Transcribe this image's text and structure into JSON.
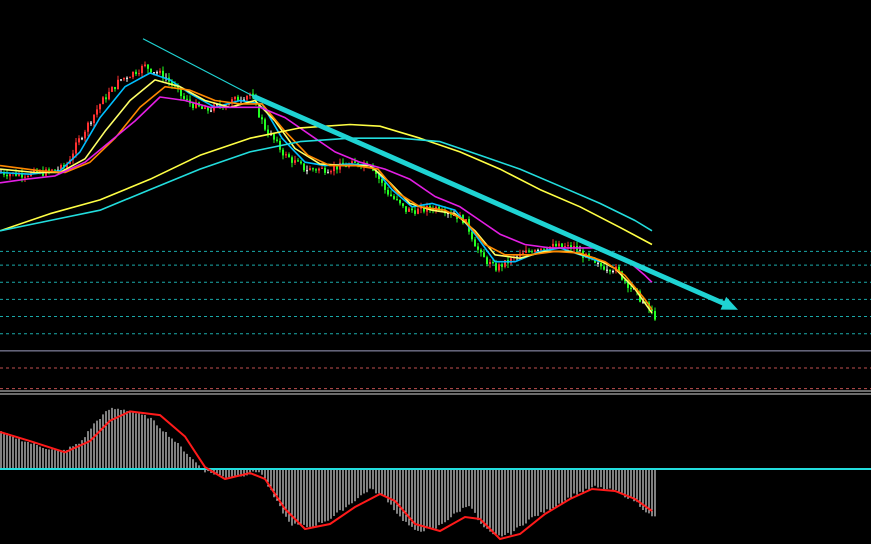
{
  "chart_data": [
    {
      "type": "candlestick",
      "panel": "price",
      "title": "",
      "xlabel": "",
      "ylabel": "",
      "ylim": [
        0,
        100
      ],
      "grid": false,
      "colors": {
        "up": "#ff3030",
        "down": "#22ff22",
        "doji": "#ffffff"
      },
      "price_path": [
        [
          0,
          57
        ],
        [
          20,
          56.5
        ],
        [
          45,
          57
        ],
        [
          65,
          58.5
        ],
        [
          80,
          67
        ],
        [
          100,
          77
        ],
        [
          120,
          84
        ],
        [
          145,
          88
        ],
        [
          165,
          85
        ],
        [
          185,
          78
        ],
        [
          205,
          75
        ],
        [
          225,
          77
        ],
        [
          250,
          80
        ],
        [
          265,
          70
        ],
        [
          285,
          62
        ],
        [
          305,
          58
        ],
        [
          325,
          58
        ],
        [
          345,
          59
        ],
        [
          370,
          60
        ],
        [
          385,
          52
        ],
        [
          405,
          46
        ],
        [
          420,
          46
        ],
        [
          440,
          47
        ],
        [
          465,
          43
        ],
        [
          480,
          33
        ],
        [
          495,
          29
        ],
        [
          515,
          32
        ],
        [
          535,
          35
        ],
        [
          555,
          35.5
        ],
        [
          575,
          35
        ],
        [
          595,
          30
        ],
        [
          615,
          29
        ],
        [
          635,
          22
        ],
        [
          655,
          15
        ]
      ],
      "moving_averages": [
        {
          "color": "#00bfff",
          "values": [
            [
              0,
              57
            ],
            [
              30,
              56.5
            ],
            [
              60,
              57.5
            ],
            [
              80,
              63
            ],
            [
              100,
              73
            ],
            [
              125,
              82
            ],
            [
              150,
              86
            ],
            [
              170,
              84
            ],
            [
              190,
              80
            ],
            [
              215,
              76
            ],
            [
              240,
              78
            ],
            [
              262,
              77
            ],
            [
              282,
              67
            ],
            [
              305,
              60
            ],
            [
              325,
              59
            ],
            [
              350,
              59.5
            ],
            [
              372,
              59
            ],
            [
              392,
              52
            ],
            [
              412,
              47
            ],
            [
              432,
              48
            ],
            [
              455,
              46
            ],
            [
              475,
              39
            ],
            [
              495,
              31
            ],
            [
              515,
              31
            ],
            [
              540,
              34
            ],
            [
              560,
              35
            ],
            [
              580,
              33
            ],
            [
              600,
              31
            ]
          ]
        },
        {
          "color": "#ffff66",
          "values": [
            [
              0,
              58
            ],
            [
              35,
              57
            ],
            [
              60,
              57
            ],
            [
              85,
              61
            ],
            [
              105,
              69
            ],
            [
              130,
              78
            ],
            [
              155,
              84
            ],
            [
              180,
              82
            ],
            [
              205,
              78
            ],
            [
              230,
              76
            ],
            [
              255,
              78
            ],
            [
              275,
              72
            ],
            [
              295,
              64
            ],
            [
              320,
              59.5
            ],
            [
              345,
              59
            ],
            [
              370,
              59
            ],
            [
              390,
              54
            ],
            [
              410,
              48
            ],
            [
              432,
              46
            ],
            [
              455,
              45
            ],
            [
              475,
              40
            ],
            [
              495,
              33
            ],
            [
              520,
              32
            ],
            [
              545,
              34
            ],
            [
              570,
              34
            ],
            [
              595,
              32
            ],
            [
              615,
              29
            ],
            [
              635,
              23
            ],
            [
              652,
              16
            ]
          ]
        },
        {
          "color": "#ff8800",
          "values": [
            [
              0,
              59
            ],
            [
              40,
              57.5
            ],
            [
              65,
              57
            ],
            [
              90,
              60
            ],
            [
              115,
              67
            ],
            [
              140,
              76
            ],
            [
              165,
              82
            ],
            [
              190,
              81
            ],
            [
              215,
              78
            ],
            [
              240,
              77
            ],
            [
              262,
              77
            ],
            [
              285,
              69
            ],
            [
              308,
              62
            ],
            [
              330,
              59
            ],
            [
              355,
              59
            ],
            [
              378,
              58
            ],
            [
              398,
              51
            ],
            [
              420,
              47
            ],
            [
              445,
              46
            ],
            [
              465,
              43
            ],
            [
              485,
              36
            ],
            [
              505,
              33
            ],
            [
              530,
              33
            ],
            [
              555,
              34
            ],
            [
              580,
              33.5
            ],
            [
              605,
              31
            ],
            [
              625,
              27
            ],
            [
              645,
              20
            ],
            [
              652,
              17
            ]
          ]
        },
        {
          "color": "#e31ee3",
          "values": [
            [
              0,
              54
            ],
            [
              25,
              55
            ],
            [
              55,
              56
            ],
            [
              85,
              60
            ],
            [
              110,
              66
            ],
            [
              135,
              72
            ],
            [
              160,
              79
            ],
            [
              185,
              78
            ],
            [
              210,
              76
            ],
            [
              235,
              76
            ],
            [
              260,
              76
            ],
            [
              285,
              73
            ],
            [
              310,
              68
            ],
            [
              335,
              63
            ],
            [
              360,
              60
            ],
            [
              385,
              58
            ],
            [
              410,
              55
            ],
            [
              435,
              50
            ],
            [
              460,
              47
            ],
            [
              480,
              43
            ],
            [
              500,
              39
            ],
            [
              525,
              36
            ],
            [
              550,
              35
            ],
            [
              575,
              35
            ],
            [
              600,
              35
            ],
            [
              625,
              32
            ],
            [
              645,
              27
            ],
            [
              652,
              25
            ]
          ]
        },
        {
          "color": "#ffff44",
          "values": [
            [
              0,
              40
            ],
            [
              50,
              45
            ],
            [
              100,
              49
            ],
            [
              150,
              55
            ],
            [
              200,
              62
            ],
            [
              250,
              67
            ],
            [
              300,
              70
            ],
            [
              350,
              71
            ],
            [
              380,
              70.5
            ],
            [
              420,
              67
            ],
            [
              460,
              63
            ],
            [
              500,
              58
            ],
            [
              540,
              52
            ],
            [
              580,
              47
            ],
            [
              620,
              41
            ],
            [
              652,
              36
            ]
          ]
        },
        {
          "color": "#22dddd",
          "values": [
            [
              0,
              40
            ],
            [
              50,
              43
            ],
            [
              100,
              46
            ],
            [
              150,
              52
            ],
            [
              200,
              58
            ],
            [
              250,
              63
            ],
            [
              300,
              66
            ],
            [
              350,
              67
            ],
            [
              400,
              67
            ],
            [
              440,
              66
            ],
            [
              480,
              62
            ],
            [
              520,
              58
            ],
            [
              560,
              53
            ],
            [
              600,
              48
            ],
            [
              635,
              43
            ],
            [
              652,
              40
            ]
          ]
        }
      ],
      "horizontal_levels": [
        {
          "value": 34,
          "color": "#1aa9a9",
          "style": "dotted"
        },
        {
          "value": 30,
          "color": "#1aa9a9",
          "style": "dotted"
        },
        {
          "value": 25,
          "color": "#1aa9a9",
          "style": "dotted"
        },
        {
          "value": 20,
          "color": "#1aa9a9",
          "style": "dotted"
        },
        {
          "value": 15,
          "color": "#1aa9a9",
          "style": "dotted"
        },
        {
          "value": 10,
          "color": "#1aa9a9",
          "style": "dotted"
        },
        {
          "value": 5,
          "color": "#9e9ec0",
          "style": "solid"
        },
        {
          "value": 0,
          "color": "#c05050",
          "style": "dotted"
        },
        {
          "value": -6,
          "color": "#c05050",
          "style": "dotted"
        }
      ],
      "trend_lines": [
        {
          "color": "#1fd3d3",
          "from": [
            143,
            96
          ],
          "to": [
            255,
            79
          ],
          "arrow": false
        },
        {
          "color": "#1fd3d3",
          "from": [
            255,
            79
          ],
          "to": [
            738,
            17
          ],
          "arrow": true
        }
      ]
    },
    {
      "type": "histogram",
      "panel": "oscillator",
      "title": "",
      "xlabel": "",
      "ylabel": "",
      "ylim": [
        -75,
        70
      ],
      "grid": false,
      "zero_line_color": "#22dddd",
      "bar_color": "#ffffff",
      "signal_color": "#ff1a1a",
      "histogram_path": [
        [
          0,
          40
        ],
        [
          30,
          28
        ],
        [
          60,
          18
        ],
        [
          80,
          28
        ],
        [
          95,
          50
        ],
        [
          110,
          65
        ],
        [
          125,
          64
        ],
        [
          150,
          55
        ],
        [
          175,
          30
        ],
        [
          195,
          8
        ],
        [
          205,
          -2
        ],
        [
          225,
          -8
        ],
        [
          245,
          -6
        ],
        [
          260,
          -2
        ],
        [
          275,
          -30
        ],
        [
          290,
          -55
        ],
        [
          310,
          -58
        ],
        [
          330,
          -50
        ],
        [
          350,
          -35
        ],
        [
          370,
          -20
        ],
        [
          385,
          -28
        ],
        [
          400,
          -48
        ],
        [
          415,
          -62
        ],
        [
          435,
          -60
        ],
        [
          455,
          -45
        ],
        [
          470,
          -35
        ],
        [
          480,
          -55
        ],
        [
          495,
          -68
        ],
        [
          510,
          -65
        ],
        [
          530,
          -50
        ],
        [
          550,
          -40
        ],
        [
          575,
          -25
        ],
        [
          595,
          -18
        ],
        [
          615,
          -22
        ],
        [
          635,
          -32
        ],
        [
          652,
          -48
        ]
      ],
      "signal_path": [
        [
          0,
          40
        ],
        [
          30,
          30
        ],
        [
          65,
          18
        ],
        [
          90,
          30
        ],
        [
          110,
          52
        ],
        [
          130,
          62
        ],
        [
          160,
          58
        ],
        [
          185,
          35
        ],
        [
          205,
          2
        ],
        [
          225,
          -10
        ],
        [
          250,
          -4
        ],
        [
          265,
          -10
        ],
        [
          285,
          -40
        ],
        [
          305,
          -60
        ],
        [
          330,
          -55
        ],
        [
          355,
          -38
        ],
        [
          380,
          -25
        ],
        [
          395,
          -32
        ],
        [
          415,
          -55
        ],
        [
          440,
          -62
        ],
        [
          465,
          -48
        ],
        [
          480,
          -50
        ],
        [
          500,
          -70
        ],
        [
          520,
          -65
        ],
        [
          545,
          -45
        ],
        [
          570,
          -30
        ],
        [
          592,
          -20
        ],
        [
          615,
          -22
        ],
        [
          635,
          -30
        ],
        [
          652,
          -42
        ]
      ]
    }
  ]
}
